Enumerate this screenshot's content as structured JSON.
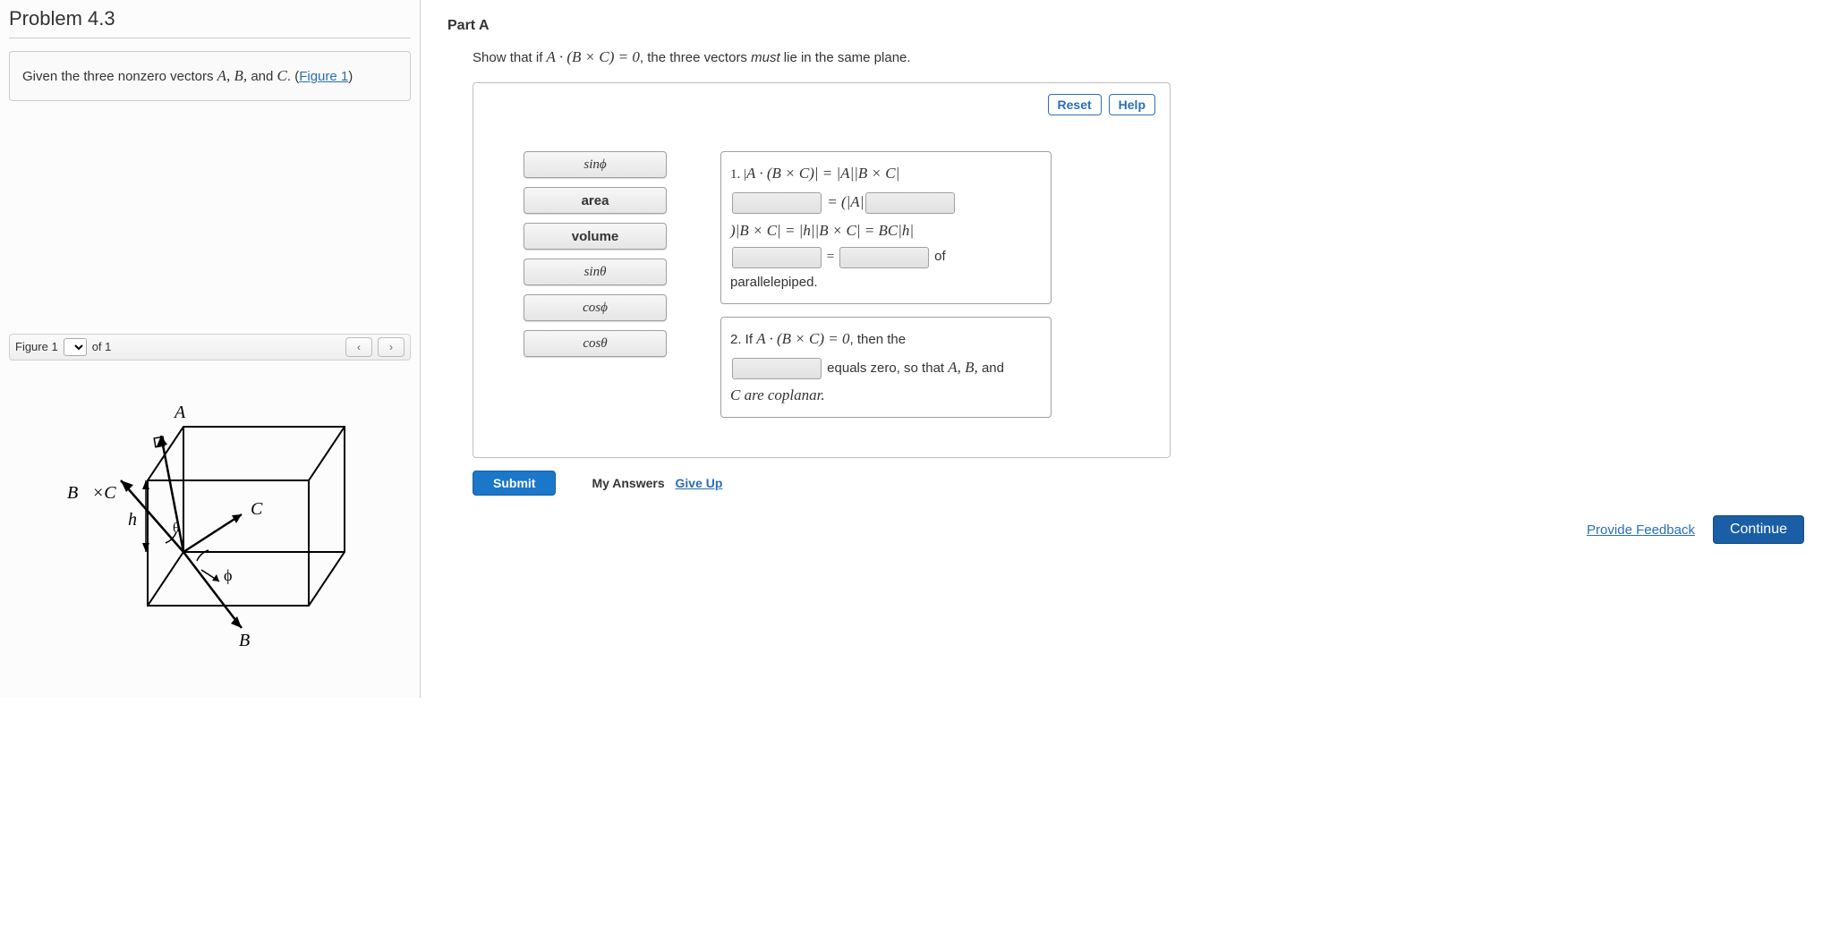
{
  "problem": {
    "title": "Problem 4.3",
    "given_pre": "Given the three nonzero vectors ",
    "given_vecs": "A, B,",
    "given_mid": " and ",
    "given_vec_c": "C",
    "given_post": ". (",
    "figure_link": "Figure 1",
    "given_close": ")"
  },
  "figure": {
    "label": "Figure 1",
    "of": " of 1",
    "labels": {
      "A": "A→",
      "BxC": "B→×C→",
      "h": "h",
      "theta": "θ",
      "C": "C→",
      "phi": "ϕ",
      "B": "B→"
    }
  },
  "part": {
    "title": "Part A",
    "instr_pre": "Show that if ",
    "instr_eq": "A · (B × C) = 0",
    "instr_mid": ", the three vectors ",
    "instr_must": "must",
    "instr_post": " lie in the same plane."
  },
  "buttons": {
    "reset": "Reset",
    "help": "Help",
    "submit": "Submit",
    "my_answers": "My Answers",
    "give_up": "Give Up",
    "feedback": "Provide Feedback",
    "continue": "Continue"
  },
  "tiles": [
    "sinϕ",
    "area",
    "volume",
    "sinθ",
    "cosϕ",
    "cosθ"
  ],
  "proof1": {
    "line1_pre": "1. |",
    "line1_eq": "A · (B × C)| = |A||B × C|",
    "line2_mid": " = (|A|",
    "line3": ")|B × C| = |h||B × C| = BC|h|",
    "line4_eq": " = ",
    "line4_of": " of",
    "line5": "parallelepiped."
  },
  "proof2": {
    "line1_pre": "2. If ",
    "line1_eq": "A · (B × C) = 0",
    "line1_post": ", then the",
    "line2_post": " equals zero, so that ",
    "line2_vecs": "A, B,",
    "line2_and": " and",
    "line3": "C are coplanar."
  }
}
